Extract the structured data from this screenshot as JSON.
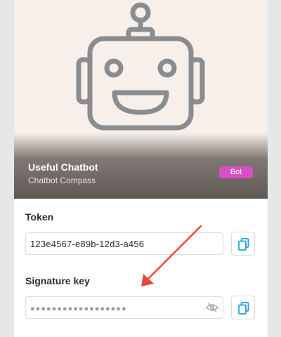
{
  "bot": {
    "name": "Useful Chatbot",
    "subtitle": "Chatbot Compass",
    "badge": "Bot",
    "avatar_icon": "robot-face-icon"
  },
  "token": {
    "label": "Token",
    "value": "123e4567-e89b-12d3-a456"
  },
  "signature": {
    "label": "Signature key",
    "masked_value": "●●●●●●●●●●●●●●●●●●",
    "visibility_icon": "eye-slash-icon"
  },
  "icons": {
    "copy": "copy-icon",
    "annotation": "red-arrow-icon"
  },
  "colors": {
    "hero_bg": "#f7efe9",
    "badge": "#d64fc3",
    "copy_icon": "#1aa3d6",
    "arrow": "#e5483a"
  }
}
